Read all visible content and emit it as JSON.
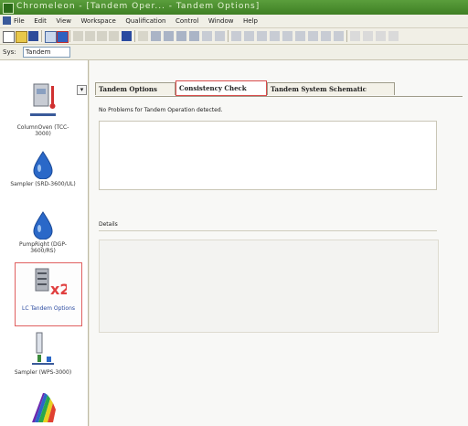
{
  "titlebar": {
    "title": "Chromeleon - [Tandem Oper... - Tandem Options]"
  },
  "menubar": {
    "items": [
      "File",
      "Edit",
      "View",
      "Workspace",
      "Qualification",
      "Control",
      "Window",
      "Help"
    ]
  },
  "sysbar": {
    "label": "Sys:",
    "value": "Tandem"
  },
  "sidebar": {
    "items": [
      {
        "caption": "ColumnOven (TCC-3000)"
      },
      {
        "caption": "Sampler (SRD-3600/UL)"
      },
      {
        "caption": "PumpRight (DGP-3600/RS)"
      },
      {
        "caption": "LC Tandem Options"
      },
      {
        "caption": "Sampler (WPS-3000)"
      }
    ]
  },
  "tabs": [
    {
      "label": "Tandem Options",
      "active": false
    },
    {
      "label": "Consistency Check",
      "active": true
    },
    {
      "label": "Tandem System Schematic",
      "active": false
    }
  ],
  "content": {
    "status_message": "No Problems for Tandem Operation detected.",
    "details_label": "Details"
  }
}
